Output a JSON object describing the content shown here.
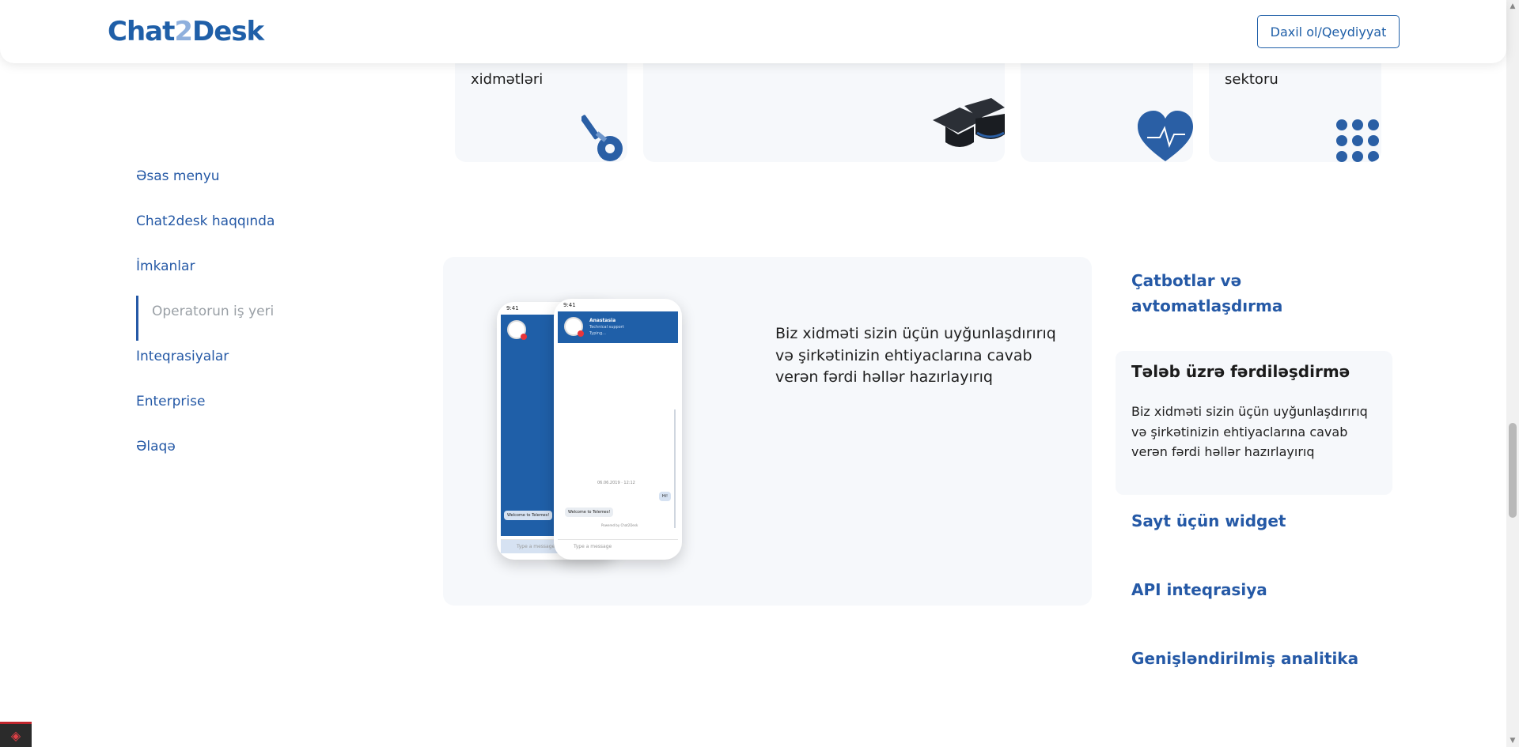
{
  "header": {
    "logo_left": "Chat",
    "logo_mid": "2",
    "logo_right": "Desk",
    "login_label": "Daxil ol/Qeydiyyat"
  },
  "categories": [
    {
      "label": "xidmətləri",
      "icon": "key-icon"
    },
    {
      "label": "",
      "icon": "graduation-cap-icon"
    },
    {
      "label": "",
      "icon": "heart-pulse-icon"
    },
    {
      "label": "sektoru",
      "icon": "dot-grid-icon"
    }
  ],
  "sidenav": {
    "items": [
      {
        "label": "Əsas menyu",
        "active": false
      },
      {
        "label": "Chat2desk haqqında",
        "active": false
      },
      {
        "label": "İmkanlar",
        "active": false
      },
      {
        "label": "Operatorun iş yeri",
        "active": true
      },
      {
        "label": "Inteqrasiyalar",
        "active": false
      },
      {
        "label": "Enterprise",
        "active": false
      },
      {
        "label": "Əlaqə",
        "active": false
      }
    ]
  },
  "panel": {
    "text": "Biz xidməti sizin üçün uyğunlaşdırırıq və şirkətinizin ehtiyaclarına cavab verən fərdi həllər hazırlayırıq",
    "phone": {
      "time": "9:41",
      "contact_name": "Anastasia",
      "contact_sub": "Technical support",
      "typing": "Typing...",
      "date": "06.06.2019 · 12:12",
      "msg_hi": "Hi!",
      "msg_welcome": "Welcome to Telemes!",
      "powered": "Powered by Chat2Desk",
      "input_placeholder": "Type a message"
    }
  },
  "accordion": {
    "items": [
      {
        "label": "Çatbotlar və avtomatlaşdırma"
      },
      {
        "label": "Sayt üçün widget"
      },
      {
        "label": "API inteqrasiya"
      },
      {
        "label": "Genişləndirilmiş analitika"
      }
    ],
    "active": {
      "title": "Tələb üzrə fərdiləşdirmə",
      "description": "Biz xidməti sizin üçün uyğunlaşdırırıq və şirkətinizin ehtiyaclarına cavab verən fərdi həllər hazırlayırıq"
    }
  },
  "colors": {
    "brand": "#1f5fa8",
    "nav_text": "#2559a6",
    "panel_bg": "#f6f8fb",
    "muted": "#9aa0a6"
  }
}
